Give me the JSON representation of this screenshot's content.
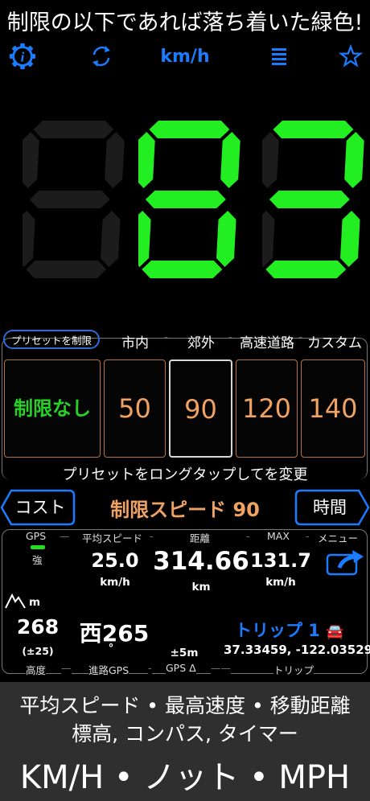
{
  "headline": "制限の以下であれば落ち着いた緑色!",
  "toolbar": {
    "info_icon": "info-gear-icon",
    "refresh_icon": "refresh-icon",
    "unit": "km/h",
    "menu_icon": "menu-lines-icon",
    "favorite_icon": "star-icon"
  },
  "speed": {
    "value": "83",
    "color": "#22ee22",
    "inactive_color": "#1c1c1c"
  },
  "presets": {
    "chip": "プリセットを制限",
    "labels": [
      "市内",
      "郊外",
      "高速道路",
      "カスタム"
    ],
    "values": [
      "制限なし",
      "50",
      "90",
      "120",
      "140"
    ],
    "selected_index": 2,
    "hint": "プリセットをロングタップしてを変更"
  },
  "limit": {
    "cost_button": "コスト",
    "text": "制限スピード 90",
    "time_button": "時間"
  },
  "stats": {
    "gps_label": "GPS",
    "gps_strength": "強",
    "avg_label": "平均スピード",
    "avg_value": "25.0",
    "avg_unit": "km/h",
    "dist_label": "距離",
    "dist_value": "314.66",
    "dist_unit": "km",
    "max_label": "MAX",
    "max_value": "131.7",
    "max_unit": "km/h",
    "menu_label": "メニュー",
    "alt_unit": "m",
    "alt_value": "268",
    "alt_acc": "(±25)",
    "alt_label": "高度",
    "heading_value": "西265",
    "heading_unit": "°",
    "heading_label": "進路GPS",
    "gps_delta": "±5m",
    "gps_delta_label": "GPS Δ",
    "trip_name": "トリップ 1",
    "trip_icon": "🚘",
    "coords": "37.33459, -122.03529",
    "trip_label": "トリップ"
  },
  "promo": {
    "line1": "平均スピード • 最高速度 • 移動距離",
    "line2": "標高, コンパス, タイマー",
    "line3": "KM/H  • ノット  • MPH"
  }
}
